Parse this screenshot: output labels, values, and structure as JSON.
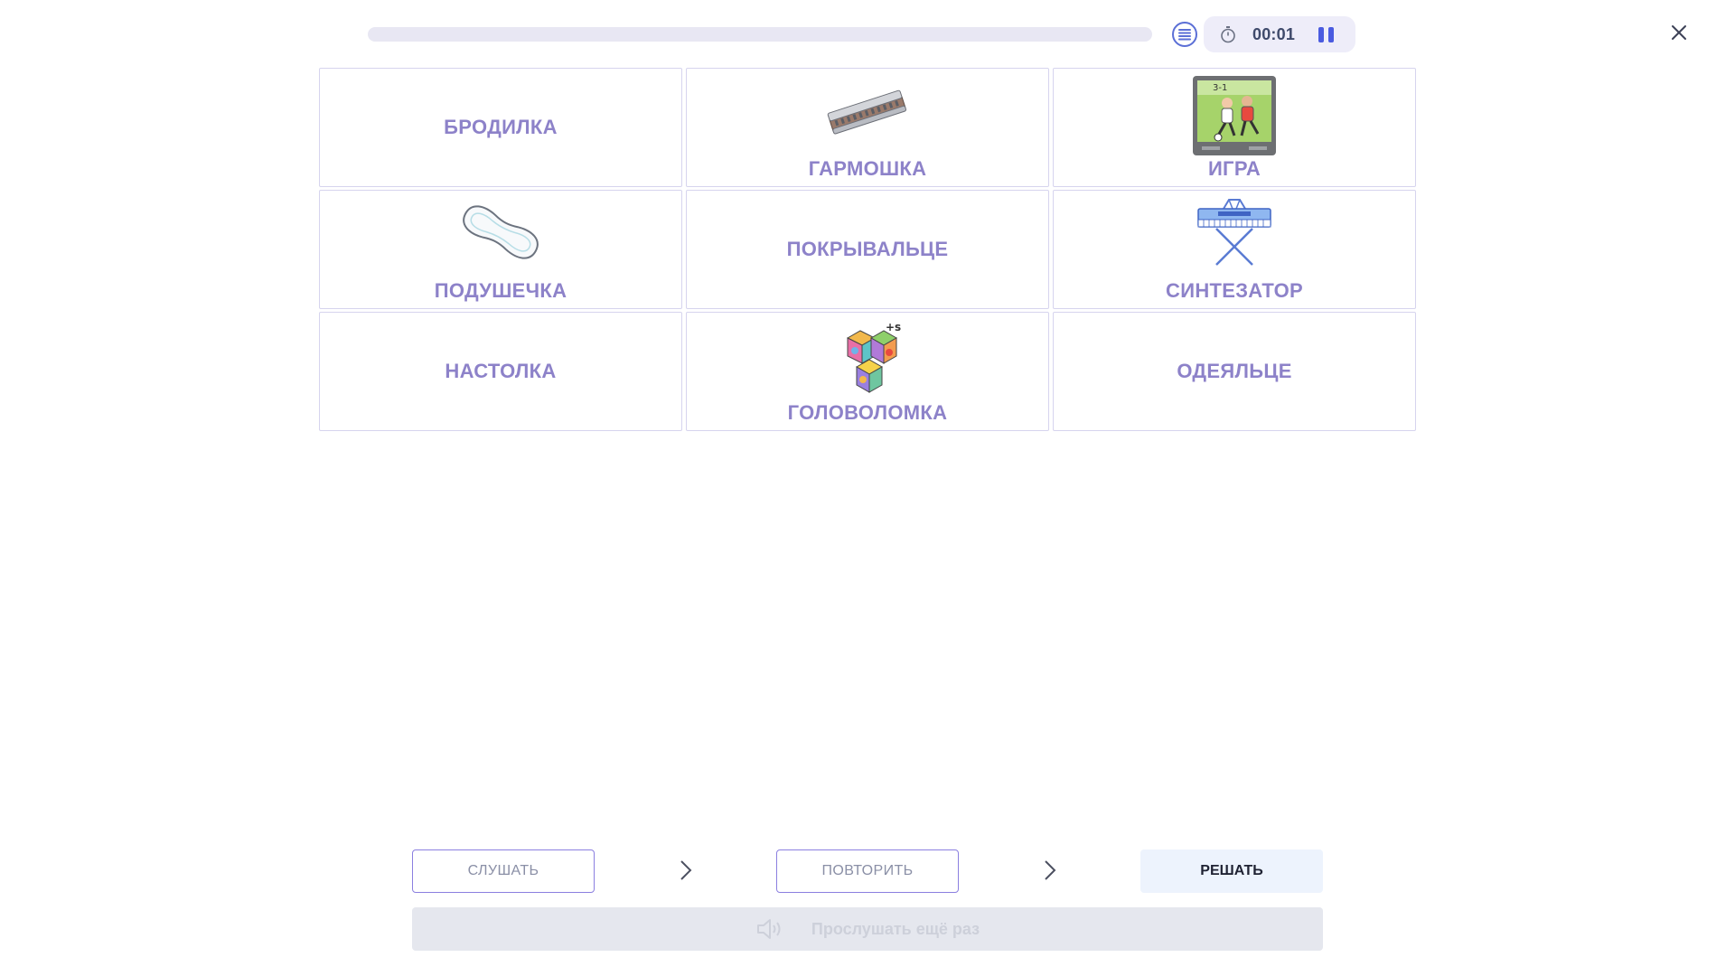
{
  "top_bar": {
    "progress_fraction": 0,
    "timer": "00:01",
    "icons": {
      "list": "list-icon",
      "timer": "stopwatch-icon",
      "pause": "pause-icon",
      "close": "close-icon"
    }
  },
  "cards": [
    {
      "word": "БРОДИЛКА",
      "image": null
    },
    {
      "word": "ГАРМОШКА",
      "image": "harmonica-icon"
    },
    {
      "word": "ИГРА",
      "image": "football-tv-icon"
    },
    {
      "word": "ПОДУШЕЧКА",
      "image": "pad-icon"
    },
    {
      "word": "ПОКРЫВАЛЬЦЕ",
      "image": null
    },
    {
      "word": "СИНТЕЗАТОР",
      "image": "synthesizer-icon"
    },
    {
      "word": "НАСТОЛКА",
      "image": null
    },
    {
      "word": "ГОЛОВОЛОМКА",
      "image": "puzzle-cubes-icon"
    },
    {
      "word": "ОДЕЯЛЬЦЕ",
      "image": null
    }
  ],
  "steps": {
    "listen_label": "СЛУШАТЬ",
    "repeat_label": "ПОВТОРИТЬ",
    "solve_label": "РЕШАТЬ"
  },
  "replay": {
    "label": "Прослушать ещё раз",
    "icon": "speaker-icon"
  },
  "colors": {
    "accent": "#8b7fe0",
    "word": "#8d82c9",
    "pause": "#4a5be0"
  }
}
